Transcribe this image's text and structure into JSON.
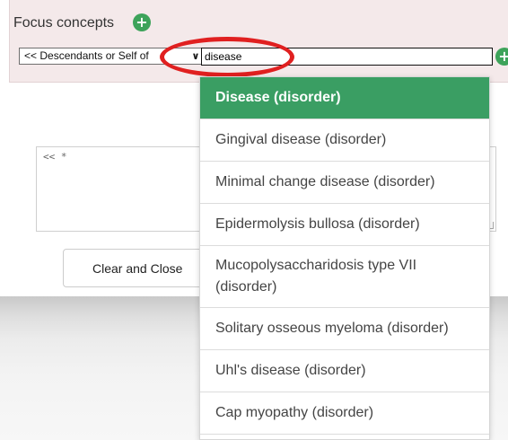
{
  "focus_concepts": {
    "title": "Focus concepts",
    "add_icon": "plus-circle-icon",
    "constraint_operator": "<< Descendants or Self of",
    "search_value": "disease"
  },
  "expression": {
    "value": "<< *"
  },
  "buttons": {
    "clear_close": "Clear and Close"
  },
  "dropdown": {
    "items": [
      "Disease (disorder)",
      "Gingival disease (disorder)",
      "Minimal change disease (disorder)",
      "Epidermolysis bullosa (disorder)",
      "Mucopolysaccharidosis type VII (disorder)",
      "Solitary osseous myeloma (disorder)",
      "Uhl's disease (disorder)",
      "Cap myopathy (disorder)"
    ],
    "selected_index": 0
  },
  "colors": {
    "accent_green": "#3a9e63",
    "panel_bg": "#f4e9ea",
    "annotation_red": "#e02020"
  }
}
